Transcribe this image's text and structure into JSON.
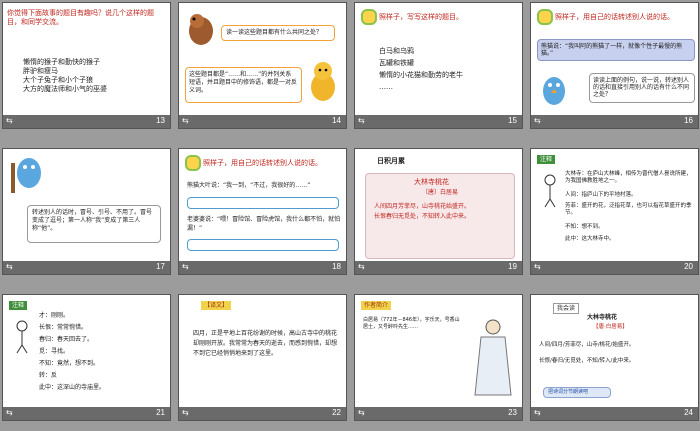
{
  "slides": [
    {
      "number": "13",
      "title": "你觉得下面故事的题目有趣吗？说几个这样的题目，和同学交流。",
      "items": [
        "懒惰的猴子和勤快的猴子",
        "胖驴和瘦马",
        "大个子兔子和小个子狼",
        "大方的魔法师和小气的巫婆"
      ]
    },
    {
      "number": "14",
      "question": "读一读这些题目都有什么共同之处？",
      "hint": "这些题目都是“……和……”的并列关系短语，并且题目中的修饰语，都是一对反义词。"
    },
    {
      "number": "15",
      "title": "照样子，写写这样的题目。",
      "items": [
        "白马和乌鸦",
        "瓦罐和铁罐",
        "懒惰的小花猫和勤劳的老牛",
        "……"
      ]
    },
    {
      "number": "16",
      "title": "照样子，用自己的话转述别人说的话。",
      "quote": "熊猫说：“我叫阿的熊猫了一样，就像个性子最慢的熊猫。”",
      "question": "读读上面的例句，说一说，转述别人的话和直接引用别人的话有什么不同之处？"
    },
    {
      "number": "17",
      "text": "转述别人的话时，冒号、引号、不用了。冒号变成了逗号；第一人称“我”变成了第三人称“他”。"
    },
    {
      "number": "18",
      "title": "照样子，用自己的话转述别人说的话。",
      "items": [
        "熊猫大叶说：“我一到，“不过，我很好的……”",
        "老婆婆说：“喂！冒险馆、冒险虎馆，我什么都不怕，就怕漏！”"
      ]
    },
    {
      "number": "19",
      "header": "日积月累",
      "poem_title": "大林寺桃花",
      "author": "〔唐〕白居易",
      "lines": [
        "人间四月芳菲尽，山寺桃花始盛开。",
        "长恨春归无觅处，不知转入此中来。"
      ]
    },
    {
      "number": "20",
      "tag": "注释",
      "notes": [
        "大林寺：在庐山大林峰，相传为晋代僧人昙诜所建，为我国佛教胜地之一。",
        "人间：指庐山下的平地村落。",
        "芳菲：盛开的花，泛指花草，也可以指花草盛开的季节。",
        "不知：想不到。",
        "此中：这大林寺中。"
      ]
    },
    {
      "number": "21",
      "tag": "注释",
      "notes": [
        "才：刚刚。",
        "长恨：常常惋惜。",
        "春归：春天回去了。",
        "觅：寻找。",
        "不知：竟然，想不到。",
        "转：反",
        "此中：这深山的寺庙里。"
      ]
    },
    {
      "number": "22",
      "tag": "【译文】",
      "text": "四月，正是平地上百花纷谢的时候，高山古寺中的桃花却刚刚开放。我常常为春天的逝去，而感到惋惜，却想不到它已经悄悄地来到了这里。"
    },
    {
      "number": "23",
      "tag": "作者简介",
      "text": "白居易（772年－846年），字乐天，号香山居士，又号醉吟先生……"
    },
    {
      "number": "24",
      "tag": "我会读",
      "poem_title": "大林寺桃花",
      "author": "【唐·白居易】",
      "lines": [
        "人间/四月/芳菲尽，山寺/桃花/始盛开。",
        "长恨/春归/无觅处，不知/转入/此中来。"
      ],
      "button": "把诗词分节朗读吧"
    }
  ],
  "colors": {
    "title_red": "#c0261e",
    "accent_green": "#3f8f3b",
    "bar": "#6a6a6a"
  }
}
